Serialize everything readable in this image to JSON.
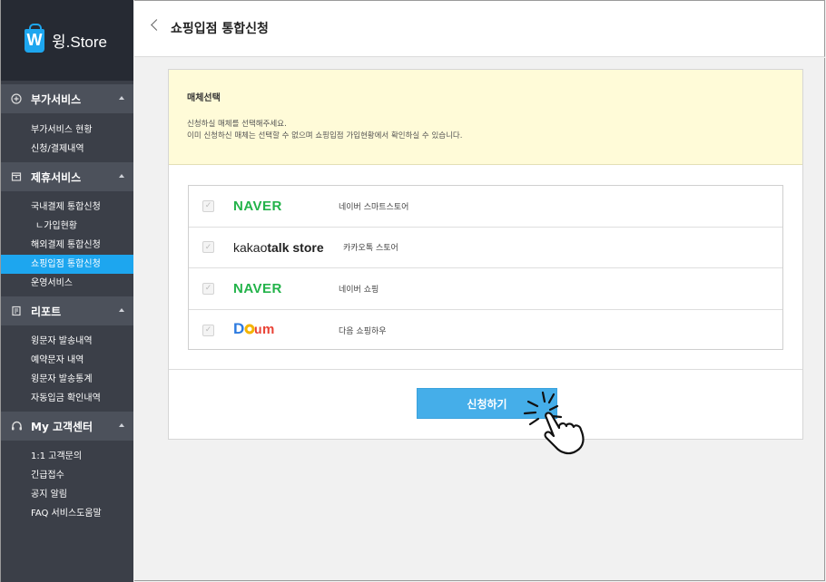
{
  "brand": {
    "logo_letter": "W",
    "name": "윙.Store"
  },
  "sidebar": {
    "sections": [
      {
        "title": "부가서비스",
        "items": [
          "부가서비스 현황",
          "신청/결제내역"
        ]
      },
      {
        "title": "제휴서비스",
        "items": [
          "국내결제 통합신청",
          "ㄴ가입현황",
          "해외결제 통합신청",
          "쇼핑입점 통합신청",
          "운영서비스"
        ],
        "active": "쇼핑입점 통합신청"
      },
      {
        "title": "리포트",
        "items": [
          "윙문자 발송내역",
          "예약문자 내역",
          "윙문자 발송통계",
          "자동입금 확인내역"
        ]
      },
      {
        "title": "My 고객센터",
        "items": [
          "1:1 고객문의",
          "긴급접수",
          "공지 알림",
          "FAQ 서비스도움말"
        ]
      }
    ]
  },
  "header": {
    "title": "쇼핑입점 통합신청"
  },
  "notice": {
    "title": "매체선택",
    "line1": "신청하실 매체를 선택해주세요.",
    "line2": "이미 신청하신 매체는 선택할 수 없으며 쇼핑입점 가입현황에서 확인하실 수 있습니다."
  },
  "media": [
    {
      "logo": "NAVER",
      "label": "네이버 스마트스토어",
      "checked": true
    },
    {
      "logo_a": "kakao",
      "logo_b": "talk store",
      "label": "카카오톡 스토어",
      "checked": true
    },
    {
      "logo": "NAVER",
      "label": "네이버 쇼핑",
      "checked": true
    },
    {
      "logo": "Daum",
      "label": "다음 쇼핑하우",
      "checked": true
    }
  ],
  "actions": {
    "apply_label": "신청하기"
  },
  "colors": {
    "accent": "#1da6ef",
    "naver": "#23b34a",
    "sidebar_bg": "#3b3f48",
    "notice_bg": "#fffbd8"
  }
}
